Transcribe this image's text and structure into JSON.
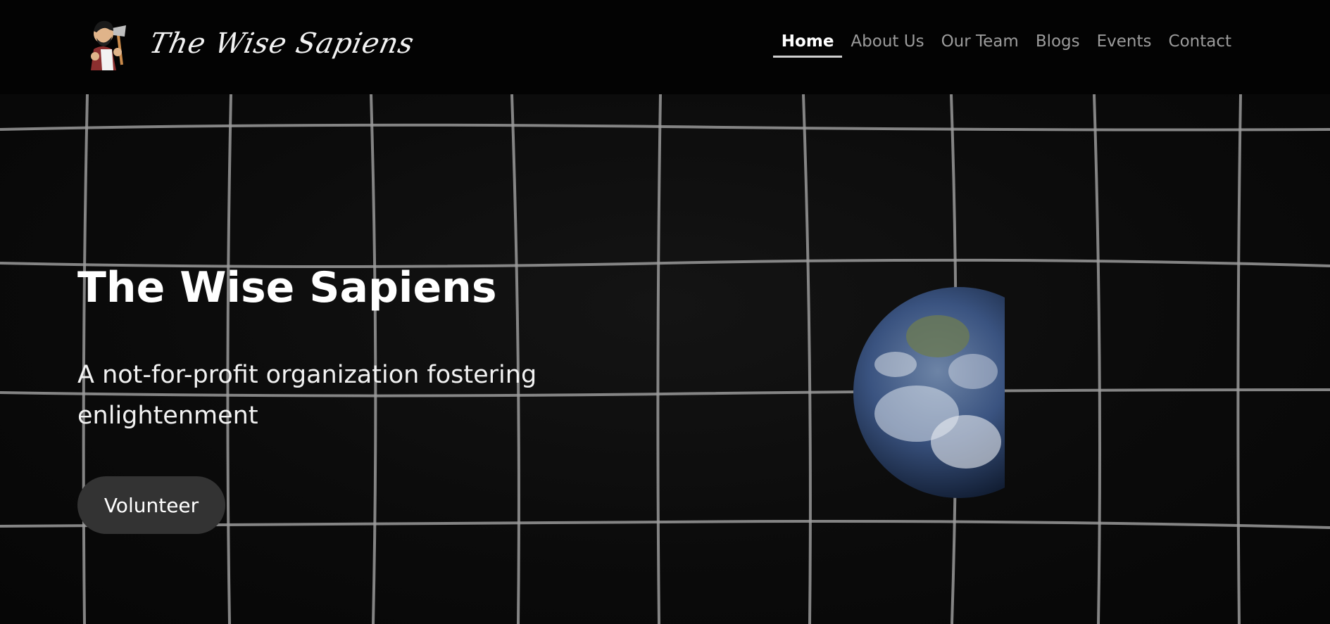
{
  "brand": {
    "logo_text": "The Wise Sapiens",
    "logo_icon": "caveman-with-axe-icon"
  },
  "nav": {
    "items": [
      {
        "label": "Home",
        "active": true
      },
      {
        "label": "About Us",
        "active": false
      },
      {
        "label": "Our Team",
        "active": false
      },
      {
        "label": "Blogs",
        "active": false
      },
      {
        "label": "Events",
        "active": false
      },
      {
        "label": "Contact",
        "active": false
      }
    ]
  },
  "hero": {
    "title": "The Wise Sapiens",
    "subtitle": "A not-for-profit organization fostering enlightenment",
    "cta_label": "Volunteer",
    "background_image": "warped-grid-with-earth",
    "earth_icon": "earth-globe-icon"
  },
  "colors": {
    "background": "#000000",
    "grid_line": "#9a9a9a",
    "nav_inactive": "#9c9c9c",
    "nav_active": "#ffffff",
    "cta_background": "#333333"
  }
}
